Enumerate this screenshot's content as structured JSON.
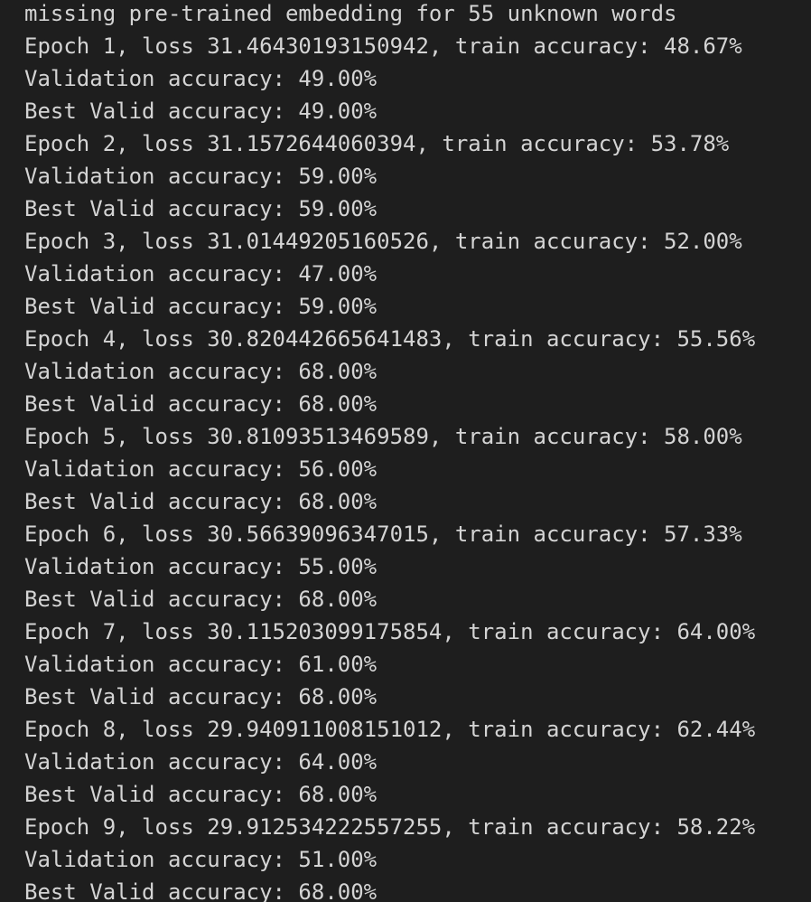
{
  "terminal": {
    "lines": [
      "missing pre-trained embedding for 55 unknown words",
      "Epoch 1, loss 31.46430193150942, train accuracy: 48.67%",
      "Validation accuracy: 49.00%",
      "Best Valid accuracy: 49.00%",
      "Epoch 2, loss 31.1572644060394, train accuracy: 53.78%",
      "Validation accuracy: 59.00%",
      "Best Valid accuracy: 59.00%",
      "Epoch 3, loss 31.01449205160526, train accuracy: 52.00%",
      "Validation accuracy: 47.00%",
      "Best Valid accuracy: 59.00%",
      "Epoch 4, loss 30.820442665641483, train accuracy: 55.56%",
      "Validation accuracy: 68.00%",
      "Best Valid accuracy: 68.00%",
      "Epoch 5, loss 30.81093513469589, train accuracy: 58.00%",
      "Validation accuracy: 56.00%",
      "Best Valid accuracy: 68.00%",
      "Epoch 6, loss 30.56639096347015, train accuracy: 57.33%",
      "Validation accuracy: 55.00%",
      "Best Valid accuracy: 68.00%",
      "Epoch 7, loss 30.115203099175854, train accuracy: 64.00%",
      "Validation accuracy: 61.00%",
      "Best Valid accuracy: 68.00%",
      "Epoch 8, loss 29.940911008151012, train accuracy: 62.44%",
      "Validation accuracy: 64.00%",
      "Best Valid accuracy: 68.00%",
      "Epoch 9, loss 29.912534222557255, train accuracy: 58.22%",
      "Validation accuracy: 51.00%",
      "Best Valid accuracy: 68.00%"
    ]
  }
}
